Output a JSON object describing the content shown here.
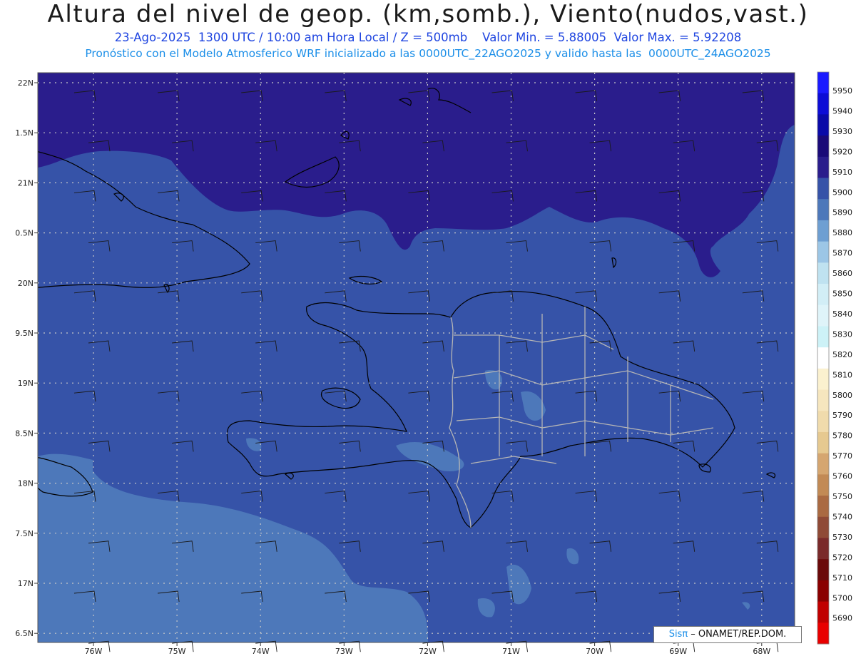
{
  "header": {
    "title": "Altura del nivel de geop. (km,somb.), Viento(nudos,vast.)",
    "line2": "23-Ago-2025  1300 UTC / 10:00 am Hora Local / Z = 500mb    Valor Min. = 5.88005  Valor Max. = 5.92208",
    "line3": "Pronóstico con el Modelo Atmosferico WRF inicializado a las 0000UTC_22AGO2025 y valido hasta las  0000UTC_24AGO2025"
  },
  "map": {
    "lat_labels": [
      "22N",
      "1.5N",
      "21N",
      "0.5N",
      "20N",
      "9.5N",
      "19N",
      "8.5N",
      "18N",
      "7.5N",
      "17N",
      "6.5N"
    ],
    "lon_labels": [
      "76W",
      "75W",
      "74W",
      "73W",
      "72W",
      "71W",
      "70W",
      "69W",
      "68W"
    ],
    "grid": true,
    "fill_colors": {
      "low": "#4d78ba",
      "mid": "#3653a8",
      "high": "#2a1d8c",
      "patch": "#5a8ecc"
    }
  },
  "colorbar": {
    "labels": [
      "5950",
      "5940",
      "5930",
      "5920",
      "5910",
      "5900",
      "5890",
      "5880",
      "5870",
      "5860",
      "5850",
      "5840",
      "5830",
      "5820",
      "5810",
      "5800",
      "5790",
      "5780",
      "5770",
      "5760",
      "5750",
      "5740",
      "5730",
      "5720",
      "5710",
      "5700",
      "5690"
    ],
    "colors": [
      "#1a1aff",
      "#0d0dd6",
      "#0a0aa8",
      "#1a0a78",
      "#2a1d8c",
      "#3653a8",
      "#4d78ba",
      "#6e9fd2",
      "#9cc6e6",
      "#bfe2f0",
      "#d2eef6",
      "#dff4f9",
      "#cdf2f7",
      "#ffffff",
      "#fbf1cf",
      "#f6e6be",
      "#f0dbac",
      "#e6c990",
      "#d5a670",
      "#c28a55",
      "#aa6a42",
      "#8f4a36",
      "#7a2a2a",
      "#6a0a0a",
      "#8a0000",
      "#c00000",
      "#e80000"
    ]
  },
  "credit": {
    "sis": "Sisπ",
    "rest": " – ONAMET/REP.DOM."
  }
}
